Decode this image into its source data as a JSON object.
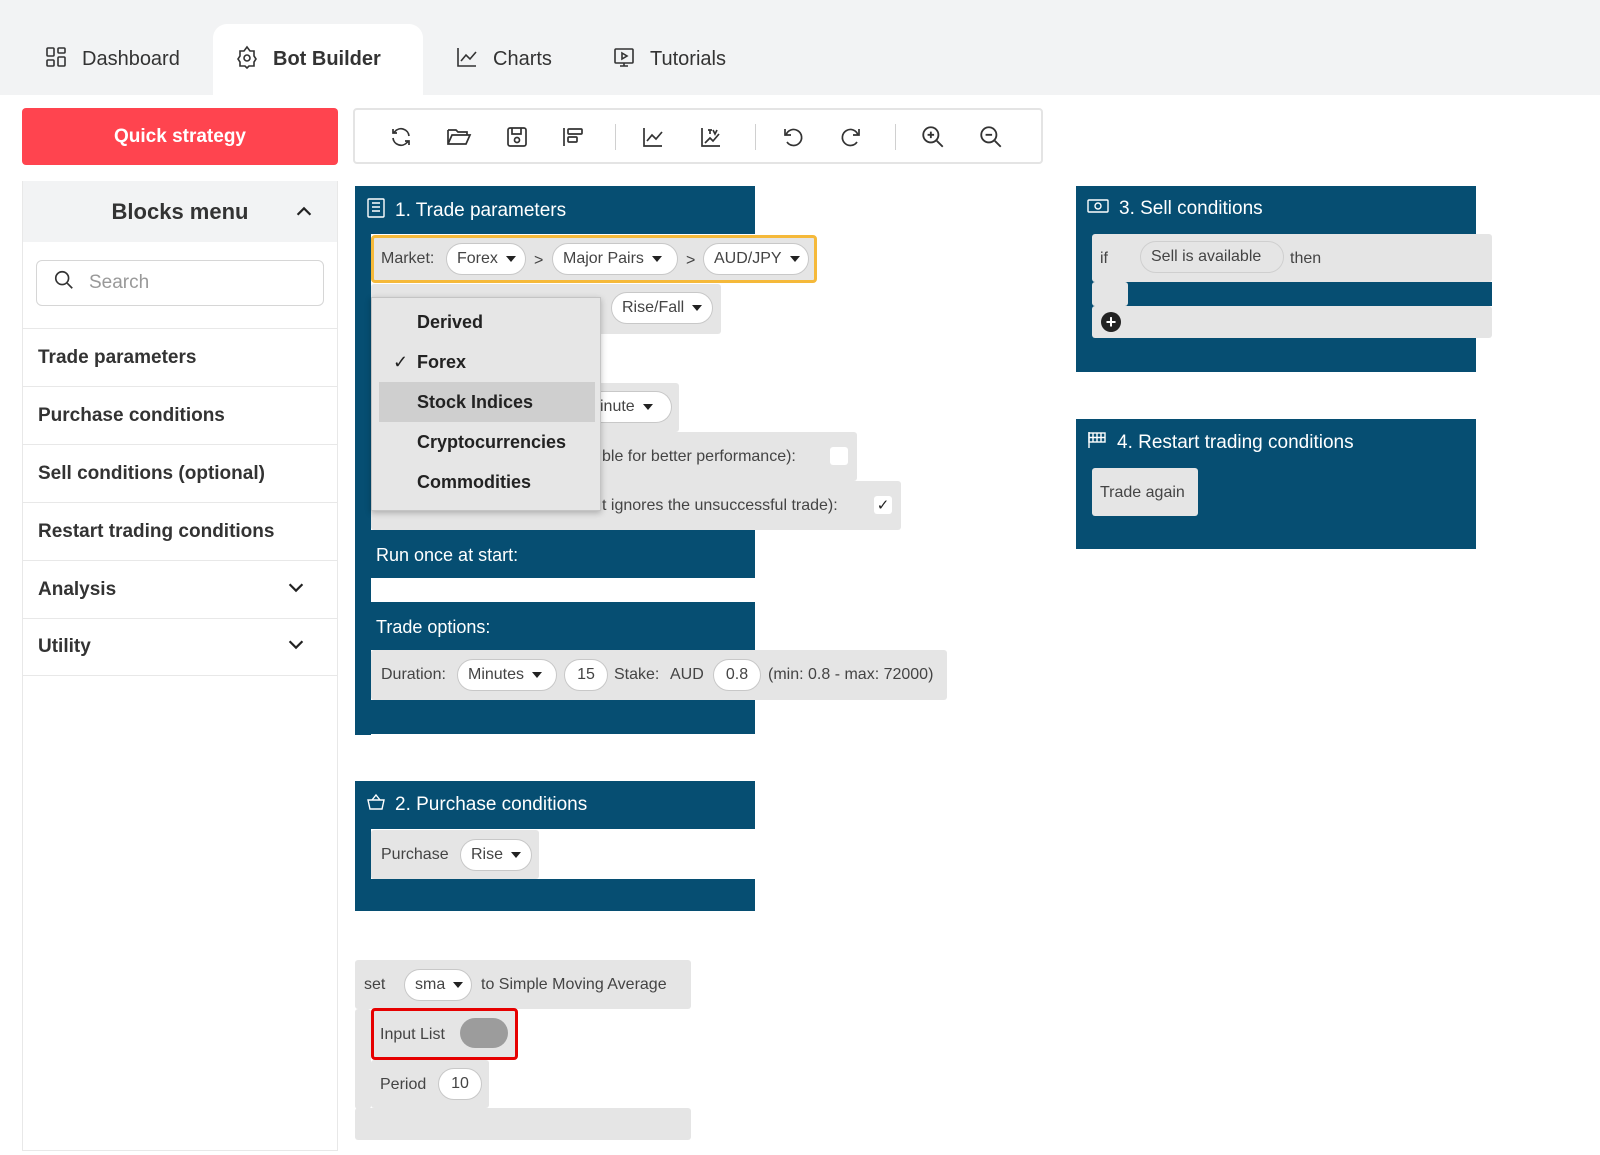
{
  "tabs": [
    {
      "label": "Dashboard",
      "icon": "dashboard-icon",
      "active": false
    },
    {
      "label": "Bot Builder",
      "icon": "bot-icon",
      "active": true
    },
    {
      "label": "Charts",
      "icon": "chart-icon",
      "active": false
    },
    {
      "label": "Tutorials",
      "icon": "tutorial-icon",
      "active": false
    }
  ],
  "sidebar": {
    "quick_strategy": "Quick strategy",
    "menu_title": "Blocks menu",
    "search_placeholder": "Search",
    "items": [
      {
        "label": "Trade parameters"
      },
      {
        "label": "Purchase conditions"
      },
      {
        "label": "Sell conditions (optional)"
      },
      {
        "label": "Restart trading conditions"
      },
      {
        "label": "Analysis",
        "expandable": true
      },
      {
        "label": "Utility",
        "expandable": true
      }
    ]
  },
  "toolbar": {
    "icons": [
      "reset-icon",
      "open-icon",
      "save-icon",
      "sort-icon",
      "chart-icon",
      "tradingview-icon",
      "undo-icon",
      "redo-icon",
      "zoom-in-icon",
      "zoom-out-icon"
    ]
  },
  "trade_parameters": {
    "title": "1. Trade parameters",
    "market_label": "Market:",
    "market": "Forex",
    "submarket": "Major Pairs",
    "symbol": "AUD/JPY",
    "sep": ">",
    "contract": "Rise/Fall",
    "candle_fragment": "inute",
    "restart_fragment": "ble for better performance):",
    "restart_last_fragment": "t ignores the unsuccessful trade):",
    "check_mark": "✓",
    "run_once": "Run once at start:",
    "trade_options": "Trade options:",
    "duration_label": "Duration:",
    "duration_unit": "Minutes",
    "duration_value": "15",
    "stake_label": "Stake:",
    "currency": "AUD",
    "stake_value": "0.8",
    "stake_range": "(min: 0.8 - max: 72000)"
  },
  "market_dropdown": {
    "options": [
      "Derived",
      "Forex",
      "Stock Indices",
      "Cryptocurrencies",
      "Commodities"
    ],
    "selected": "Forex",
    "highlighted": "Stock Indices"
  },
  "purchase_conditions": {
    "title": "2. Purchase conditions",
    "purchase_label": "Purchase",
    "purchase_value": "Rise"
  },
  "sell_conditions": {
    "title": "3. Sell conditions",
    "if": "if",
    "condition": "Sell is available",
    "then": "then"
  },
  "restart_conditions": {
    "title": "4. Restart trading conditions",
    "action": "Trade again"
  },
  "sma_block": {
    "set": "set",
    "variable": "sma",
    "to": "to Simple Moving Average",
    "input_list": "Input List",
    "period_label": "Period",
    "period_value": "10"
  },
  "colors": {
    "accent": "#ff444f",
    "block": "#064e72",
    "highlight_border": "#f5b93a",
    "error_border": "#e60000"
  }
}
